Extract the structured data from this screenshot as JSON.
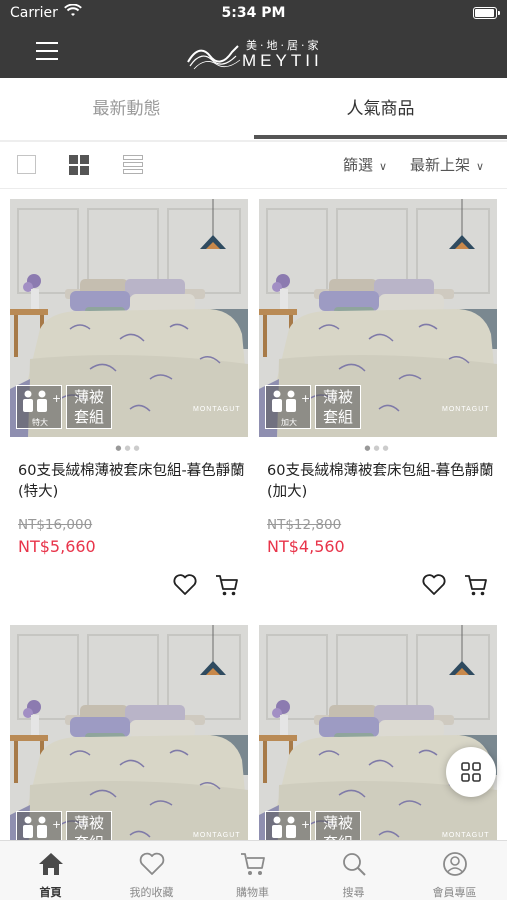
{
  "status_bar": {
    "carrier": "Carrier",
    "time": "5:34 PM"
  },
  "header": {
    "logo_cn": "美·地·居·家",
    "logo_en": "MEYTII"
  },
  "tabs": [
    {
      "label": "最新動態",
      "active": false
    },
    {
      "label": "人氣商品",
      "active": true
    }
  ],
  "toolbar": {
    "filter_label": "篩選",
    "sort_label": "最新上架",
    "view_mode": "grid"
  },
  "products": [
    {
      "name": "60支長絨棉薄被套床包組-暮色靜蘭 (特大)",
      "original_price": "NT$16,000",
      "price": "NT$5,660",
      "size_badge": "特大",
      "type_badge": [
        "薄被",
        "套組"
      ],
      "brand": "MONTAGUT"
    },
    {
      "name": "60支長絨棉薄被套床包組-暮色靜蘭 (加大)",
      "original_price": "NT$12,800",
      "price": "NT$4,560",
      "size_badge": "加大",
      "type_badge": [
        "薄被",
        "套組"
      ],
      "brand": "MONTAGUT"
    },
    {
      "name": "",
      "size_badge": "",
      "type_badge": [
        "薄被",
        "套組"
      ],
      "brand": "MONTAGUT"
    },
    {
      "name": "",
      "size_badge": "",
      "type_badge": [
        "薄被",
        "套組"
      ],
      "brand": "MONTAGUT"
    }
  ],
  "bottom_nav": [
    {
      "label": "首頁",
      "icon": "home-icon",
      "active": true
    },
    {
      "label": "我的收藏",
      "icon": "heart-icon",
      "active": false
    },
    {
      "label": "購物車",
      "icon": "cart-icon",
      "active": false
    },
    {
      "label": "搜尋",
      "icon": "search-icon",
      "active": false
    },
    {
      "label": "會員專區",
      "icon": "user-icon",
      "active": false
    }
  ],
  "colors": {
    "header_bg": "#3a3a3a",
    "sale_price": "#e8344a",
    "active_tab": "#555555"
  }
}
